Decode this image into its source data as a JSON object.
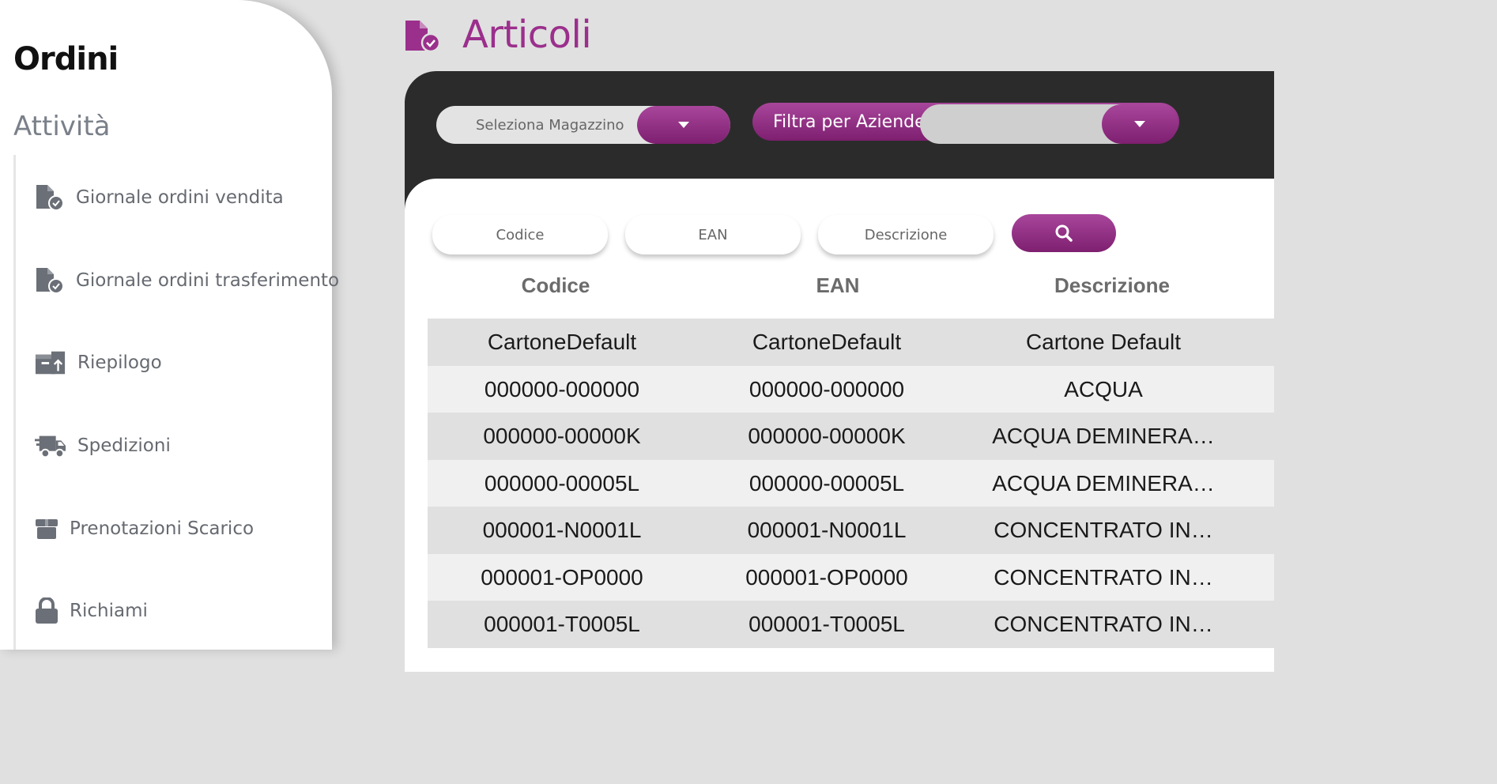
{
  "sidebar": {
    "title": "Ordini",
    "section": "Attività",
    "items": [
      {
        "label": "Giornale ordini vendita",
        "icon": "file-check-icon"
      },
      {
        "label": "Giornale ordini trasferimento",
        "icon": "file-check-icon"
      },
      {
        "label": "Riepilogo",
        "icon": "boxes-upload-icon"
      },
      {
        "label": "Spedizioni",
        "icon": "truck-icon"
      },
      {
        "label": "Prenotazioni Scarico",
        "icon": "box-icon"
      },
      {
        "label": "Richiami",
        "icon": "lock-icon"
      }
    ]
  },
  "header": {
    "title": "Articoli",
    "icon": "file-check-icon"
  },
  "filters": {
    "warehouse_placeholder": "Seleziona Magazzino",
    "company_label": "Filtra per Aziende",
    "code_placeholder": "Codice",
    "ean_placeholder": "EAN",
    "description_placeholder": "Descrizione"
  },
  "table": {
    "headers": [
      "Codice",
      "EAN",
      "Descrizione"
    ],
    "rows": [
      [
        "CartoneDefault",
        "CartoneDefault",
        "Cartone Default"
      ],
      [
        "000000-000000",
        "000000-000000",
        "ACQUA"
      ],
      [
        "000000-00000K",
        "000000-00000K",
        "ACQUA DEMINERA…"
      ],
      [
        "000000-00005L",
        "000000-00005L",
        "ACQUA DEMINERA…"
      ],
      [
        "000001-N0001L",
        "000001-N0001L",
        "CONCENTRATO IN…"
      ],
      [
        "000001-OP0000",
        "000001-OP0000",
        "CONCENTRATO IN…"
      ],
      [
        "000001-T0005L",
        "000001-T0005L",
        "CONCENTRATO IN…"
      ]
    ]
  },
  "colors": {
    "accent": "#9b2f8c",
    "dark_panel": "#2b2b2b"
  }
}
